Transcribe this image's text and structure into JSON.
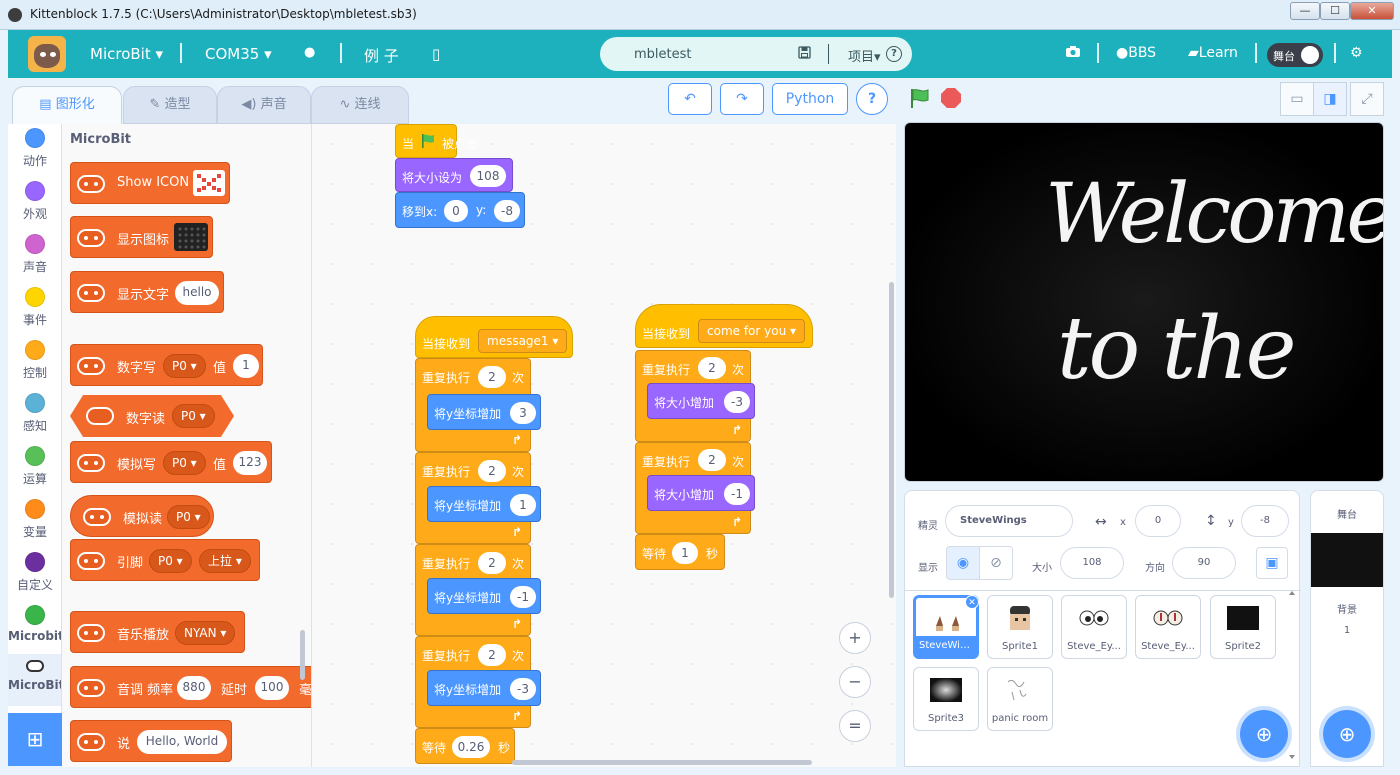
{
  "window": {
    "title": "Kittenblock 1.7.5 (C:\\Users\\Administrator\\Desktop\\mbletest.sb3)",
    "minimize": "—",
    "maximize": "☐",
    "close": "✕"
  },
  "menubar": {
    "device": "MicroBit ▾",
    "port": "COM35 ▾",
    "globe": "●",
    "examples": "例 子",
    "chip": "▯",
    "project_name": "mbletest",
    "save_icon": "💾",
    "project_menu": "项目▾",
    "help": "?",
    "camera": "📷",
    "bbs": "BBS",
    "learn": "Learn",
    "stage_toggle": "舞台",
    "settings": "⚙"
  },
  "tabs": [
    {
      "label": "图形化",
      "icon": "▤"
    },
    {
      "label": "造型",
      "icon": "✎"
    },
    {
      "label": "声音",
      "icon": "◀)"
    },
    {
      "label": "连线",
      "icon": "∿"
    }
  ],
  "toolbar": {
    "undo": "↶",
    "redo": "↷",
    "python": "Python",
    "help": "?"
  },
  "categories": [
    {
      "label": "动作",
      "color": "#4c97ff"
    },
    {
      "label": "外观",
      "color": "#9966ff"
    },
    {
      "label": "声音",
      "color": "#cf63cf"
    },
    {
      "label": "事件",
      "color": "#ffd500"
    },
    {
      "label": "控制",
      "color": "#ffab19"
    },
    {
      "label": "感知",
      "color": "#5cb1d6"
    },
    {
      "label": "运算",
      "color": "#59c059"
    },
    {
      "label": "变量",
      "color": "#ff8c1a"
    },
    {
      "label": "自定义",
      "color": "#6b2fa0"
    },
    {
      "label": "Microbit",
      "color": "#3ab54a"
    },
    {
      "label": "MicroBit",
      "color": "#ffffff"
    }
  ],
  "palette": {
    "heading": "MicroBit",
    "blocks": {
      "show_icon": "Show ICON",
      "show_image": "显示图标",
      "show_text": "显示文字",
      "show_text_value": "hello",
      "digital_write": "数字写",
      "digital_write_pin": "P0 ▾",
      "digital_write_val_label": "值",
      "digital_write_val": "1",
      "digital_read": "数字读",
      "digital_read_pin": "P0 ▾",
      "analog_write": "模拟写",
      "analog_write_pin": "P0 ▾",
      "analog_write_val_label": "值",
      "analog_write_val": "123",
      "analog_read": "模拟读",
      "analog_read_pin": "P0 ▾",
      "pin": "引脚",
      "pin_pin": "P0 ▾",
      "pin_mode": "上拉 ▾",
      "music": "音乐播放",
      "music_tune": "NYAN ▾",
      "tone": "音调 频率",
      "tone_freq": "880",
      "tone_delay_label": "延时",
      "tone_delay": "100",
      "tone_unit": "毫",
      "say": "说",
      "say_value": "Hello, World"
    }
  },
  "scripts": {
    "s1": {
      "hat": "当",
      "hat_suffix": "被点击",
      "set_size": "将大小设为",
      "set_size_val": "108",
      "goto": "移到x:",
      "goto_x": "0",
      "goto_y_label": "y:",
      "goto_y": "-8"
    },
    "s2": {
      "hat": "当接收到",
      "message": "message1 ▾",
      "repeat": "重复执行",
      "times": "次",
      "change_y": "将y坐标增加",
      "loops": [
        {
          "count": "2",
          "delta": "3"
        },
        {
          "count": "2",
          "delta": "1"
        },
        {
          "count": "2",
          "delta": "-1"
        },
        {
          "count": "2",
          "delta": "-3"
        }
      ],
      "wait": "等待",
      "wait_val": "0.26",
      "wait_unit": "秒"
    },
    "s3": {
      "hat": "当接收到",
      "message": "come for you ▾",
      "repeat": "重复执行",
      "times": "次",
      "change_size": "将大小增加",
      "loops": [
        {
          "count": "2",
          "delta": "-3"
        },
        {
          "count": "2",
          "delta": "-1"
        }
      ],
      "wait": "等待",
      "wait_val": "1",
      "wait_unit": "秒"
    }
  },
  "zoom": {
    "in": "+",
    "out": "−",
    "reset": "="
  },
  "stage": {
    "line1": "Welcome",
    "line2": "to  the"
  },
  "sprite_info": {
    "sprite_label": "精灵",
    "sprite_name": "SteveWings",
    "x_label": "x",
    "x": "0",
    "y_label": "y",
    "y": "-8",
    "show_label": "显示",
    "size_label": "大小",
    "size": "108",
    "direction_label": "方向",
    "direction": "90"
  },
  "sprites": [
    {
      "name": "SteveWings",
      "selected": true
    },
    {
      "name": "Sprite1",
      "selected": false
    },
    {
      "name": "Steve_Ey...",
      "selected": false
    },
    {
      "name": "Steve_Ey...",
      "selected": false
    },
    {
      "name": "Sprite2",
      "selected": false
    },
    {
      "name": "Sprite3",
      "selected": false
    },
    {
      "name": "panic room",
      "selected": false
    }
  ],
  "stage_pane": {
    "heading": "舞台",
    "backdrops_label": "背景",
    "backdrop_count": "1"
  }
}
